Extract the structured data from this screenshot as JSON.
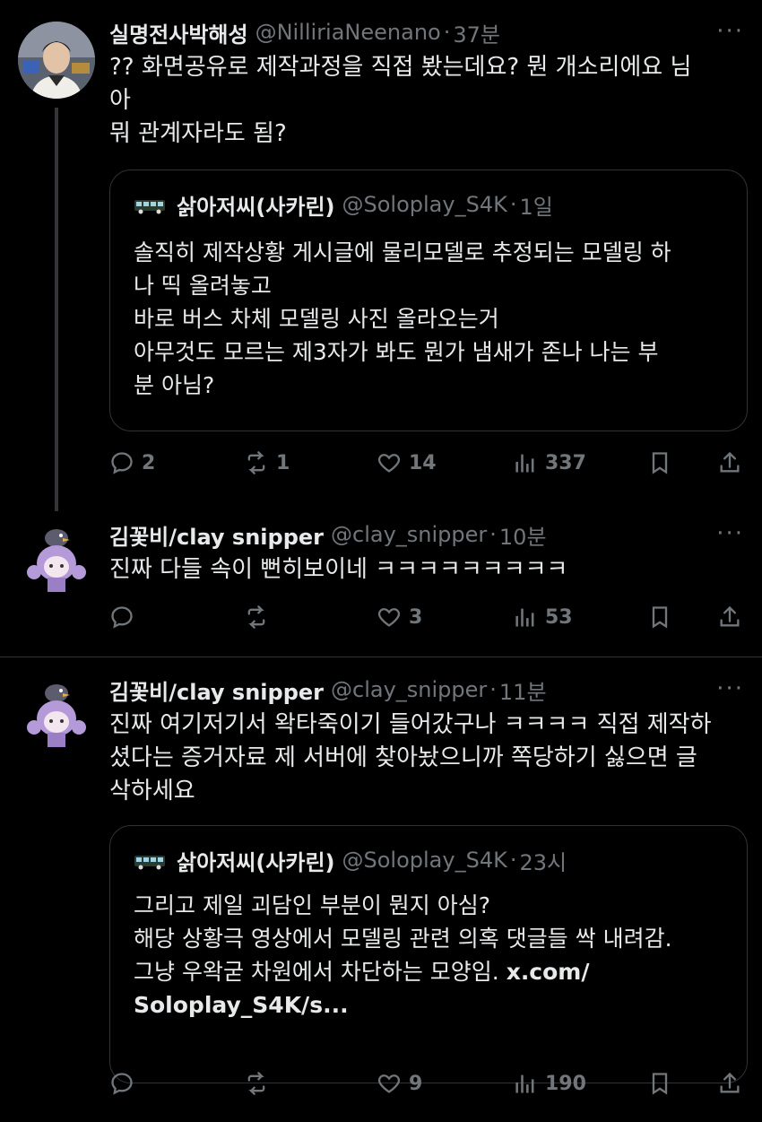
{
  "tweets": [
    {
      "name": "실명전사박해성",
      "handle": "@NilliriaNeenano",
      "time": "37분",
      "body": "?? 화면공유로 제작과정을 직접 봤는데요? 뭔 개소리에요 님\n아\n뭐 관계자라도 됨?",
      "quote": {
        "name": "삵아저씨(사카린)",
        "handle": "@Soloplay_S4K",
        "time": "1일",
        "body": "솔직히 제작상황 게시글에 물리모델로 추정되는 모델링 하\n나 띡 올려놓고\n바로 버스 차체 모델링 사진 올라오는거\n아무것도 모르는 제3자가 봐도 뭔가 냄새가 존나 나는 부\n분 아님?"
      },
      "stats": {
        "replies": "2",
        "reposts": "1",
        "likes": "14",
        "views": "337"
      }
    },
    {
      "name": "김꽃비/clay snipper",
      "handle": "@clay_snipper",
      "time": "10분",
      "body": "진짜 다들 속이 뻔히보이네 ㅋㅋㅋㅋㅋㅋㅋㅋㅋ",
      "stats": {
        "replies": "",
        "reposts": "",
        "likes": "3",
        "views": "53"
      }
    },
    {
      "name": "김꽃비/clay snipper",
      "handle": "@clay_snipper",
      "time": "11분",
      "body": "진짜 여기저기서 왁타죽이기 들어갔구나 ㅋㅋㅋㅋ 직접 제작하\n셨다는 증거자료 제 서버에 찾아놨으니까 쪽당하기 싫으면 글\n삭하세요",
      "quote": {
        "name": "삵아저씨(사카린)",
        "handle": "@Soloplay_S4K",
        "time": "23시",
        "body": "그리고 제일 괴담인 부분이 뭔지 아심?\n해당 상황극 영상에서 모델링 관련 의혹 댓글들 싹 내려감.\n그냥 우왁굳 차원에서 차단하는 모양임. ",
        "link_line1": "x.com/",
        "link_line2": "Soloplay_S4K/s..."
      },
      "stats": {
        "replies": "",
        "reposts": "",
        "likes": "9",
        "views": "190"
      }
    }
  ],
  "more_label": "···",
  "dot": "·",
  "colors": {
    "background": "#000000",
    "text": "#e7e9ea",
    "muted": "#71767b",
    "border": "#2f3336"
  }
}
